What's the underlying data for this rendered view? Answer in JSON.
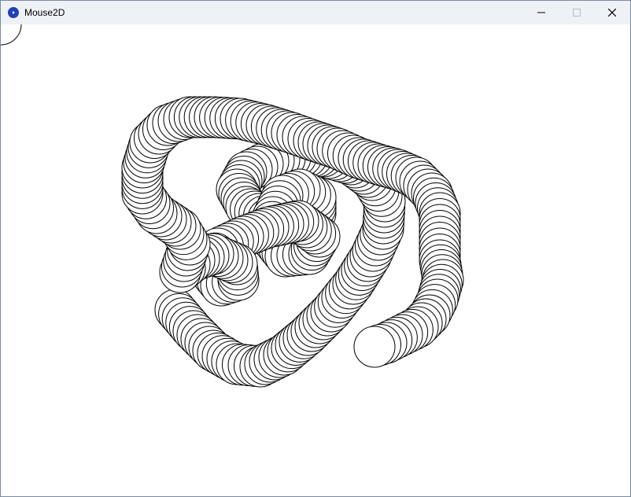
{
  "window": {
    "title": "Mouse2D",
    "app_icon": "processing-icon",
    "controls": [
      "minimize-icon",
      "maximize-icon",
      "close-icon"
    ],
    "colors": {
      "titlebar": "#eef1f6",
      "accent": "#1f3fb8",
      "canvas": "#ffffff",
      "stroke": "#000000"
    }
  }
}
